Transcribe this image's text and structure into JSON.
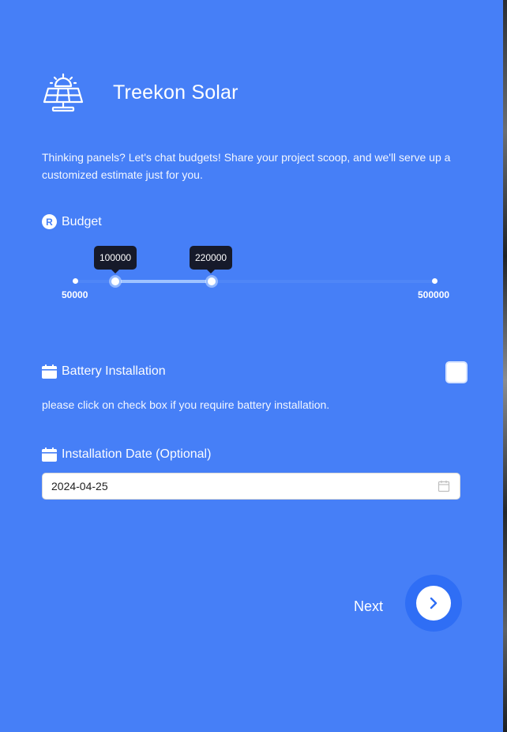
{
  "app": {
    "brand_name": "Treekon Solar",
    "logo_icon": "solar-panel-icon"
  },
  "intro": {
    "text": "Thinking panels? Let's chat budgets! Share your project scoop, and we'll serve up a customized estimate just for you."
  },
  "budget": {
    "label": "Budget",
    "badge": "R",
    "min": 50000,
    "max": 500000,
    "min_label": "50000",
    "max_label": "500000",
    "range_low": "100000",
    "range_high": "220000"
  },
  "battery": {
    "label": "Battery Installation",
    "icon": "calendar-icon",
    "checked": false,
    "hint": "please click on check box if you require battery installation."
  },
  "installation_date": {
    "label": "Installation Date (Optional)",
    "icon": "calendar-icon",
    "value": "2024-04-25"
  },
  "navigation": {
    "next_label": "Next",
    "next_icon": "chevron-right-icon"
  },
  "colors": {
    "background": "#467ff7",
    "tooltip": "#161a2a",
    "range": "#9fc3ff",
    "button_ring": "#2f6ef5"
  }
}
